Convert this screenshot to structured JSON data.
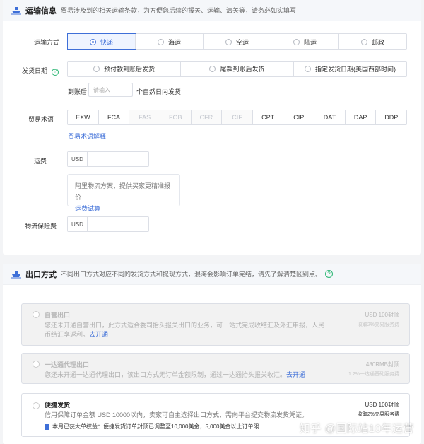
{
  "transport": {
    "title": "运输信息",
    "desc": "贸易涉及到的相关运输条款，为方便您后续的报关、运输、清关等，请务必如实填写",
    "method_label": "运输方式",
    "methods": [
      {
        "label": "快递",
        "active": true
      },
      {
        "label": "海运",
        "active": false
      },
      {
        "label": "空运",
        "active": false
      },
      {
        "label": "陆运",
        "active": false
      },
      {
        "label": "邮政",
        "active": false
      }
    ],
    "ship_date_label": "发货日期",
    "ship_date_help": "?",
    "ship_date_options": [
      "预付款到账后发货",
      "尾款到账后发货",
      "指定发货日期(美国西部时间)"
    ],
    "arrival_prefix": "到账后",
    "arrival_placeholder": "请输入",
    "arrival_suffix": "个自然日内发货",
    "terms_label": "贸易术语",
    "terms": [
      {
        "label": "EXW",
        "disabled": false
      },
      {
        "label": "FCA",
        "disabled": false
      },
      {
        "label": "FAS",
        "disabled": true
      },
      {
        "label": "FOB",
        "disabled": true
      },
      {
        "label": "CFR",
        "disabled": true
      },
      {
        "label": "CIF",
        "disabled": true
      },
      {
        "label": "CPT",
        "disabled": false
      },
      {
        "label": "CIP",
        "disabled": false
      },
      {
        "label": "DAT",
        "disabled": false
      },
      {
        "label": "DAP",
        "disabled": false
      },
      {
        "label": "DDP",
        "disabled": false
      }
    ],
    "terms_link": "贸易术语解释",
    "freight_label": "运费",
    "currency": "USD",
    "freight_note": "阿里物流方案，提供买家更精准报价",
    "freight_note_link": "运费试算",
    "insurance_label": "物流保险费",
    "insurance_currency": "USD"
  },
  "export": {
    "title": "出口方式",
    "desc": "不同出口方式对应不同的发货方式和提现方式，混海会影响订单完结，请先了解清楚区别点。",
    "help": "?",
    "options": [
      {
        "title": "自营出口",
        "desc_line1": "您还未开通自营出口，此方式适合委司抬头报关出口的业务，可一站式完成收结汇及外汇申报，人民",
        "desc_line2": "币结汇享返利。",
        "link": "去开通",
        "fee": "USD 100封顶",
        "sub": "收取2%交易服务费",
        "enabled": false
      },
      {
        "title": "一达通代理出口",
        "desc_line1": "您还未开通一达通代理出口，该出口方式无订单金额限制，通过一达通抬头报关收汇。",
        "link": "去开通",
        "fee": "480RMB封顶",
        "sub": "1.2%一达通基础服务费",
        "enabled": false
      },
      {
        "title": "便捷发货",
        "desc_line1": "信用保障订单金额 USD 10000以内，卖家可自主选择出口方式，需向平台提交物流发货凭证。",
        "benefit": "本月已获大单权益：便捷发货订单封顶已调整至10,000美金，5,000美金以上订单限",
        "fee": "USD 100封顶",
        "sub": "收取2%交易服务费",
        "enabled": true
      }
    ]
  },
  "watermark": "知乎 @国际站10年运营",
  "colors": {
    "accent": "#3e6fd8",
    "help_green": "#2bb673",
    "page_bg": "#f3f4f6"
  },
  "icons": {
    "section_transport": "ship-icon",
    "section_export": "ship-icon"
  }
}
